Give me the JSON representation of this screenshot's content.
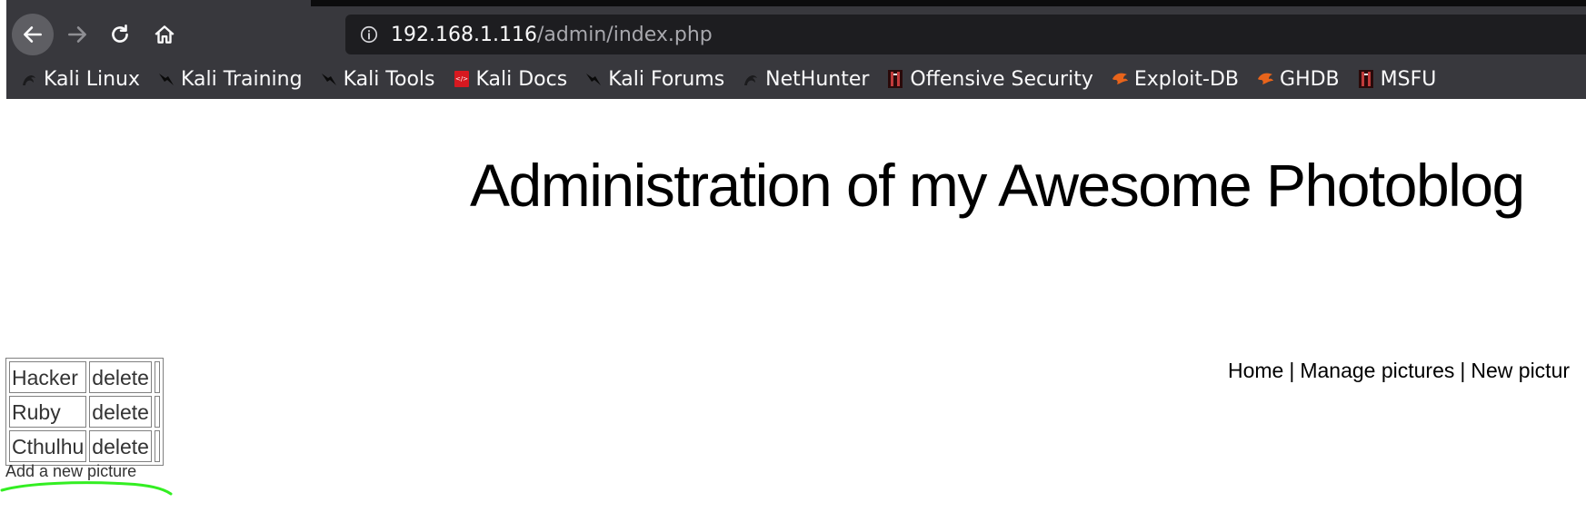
{
  "browser": {
    "url_host": "192.168.1.116",
    "url_path": "/admin/index.php",
    "bookmarks": [
      {
        "label": "Kali Linux",
        "icon": "kali-dragon-icon",
        "color": "#2a2a2e"
      },
      {
        "label": "Kali Training",
        "icon": "kali-dragon-icon",
        "color": "#111111"
      },
      {
        "label": "Kali Tools",
        "icon": "kali-dragon-icon",
        "color": "#111111"
      },
      {
        "label": "Kali Docs",
        "icon": "kali-docs-icon",
        "color": "#d71920"
      },
      {
        "label": "Kali Forums",
        "icon": "kali-dragon-icon",
        "color": "#111111"
      },
      {
        "label": "NetHunter",
        "icon": "kali-dragon-icon",
        "color": "#2a2a2e"
      },
      {
        "label": "Offensive Security",
        "icon": "offsec-icon",
        "color": "#7a1a1a"
      },
      {
        "label": "Exploit-DB",
        "icon": "exploit-db-icon",
        "color": "#e8641b"
      },
      {
        "label": "GHDB",
        "icon": "exploit-db-icon",
        "color": "#e8641b"
      },
      {
        "label": "MSFU",
        "icon": "offsec-icon",
        "color": "#7a1a1a"
      }
    ]
  },
  "page": {
    "title": "Administration of my Awesome Photoblog",
    "nav": {
      "home": "Home",
      "manage": "Manage pictures",
      "new": "New pictur",
      "separator": "|"
    },
    "pictures": [
      {
        "name": "Hacker",
        "action": "delete"
      },
      {
        "name": "Ruby",
        "action": "delete"
      },
      {
        "name": "Cthulhu",
        "action": "delete"
      }
    ],
    "add_link": "Add a new picture"
  },
  "colors": {
    "chrome_bg": "#38383d",
    "urlbar_bg": "#1d1d20",
    "annotation": "#33ee22"
  }
}
